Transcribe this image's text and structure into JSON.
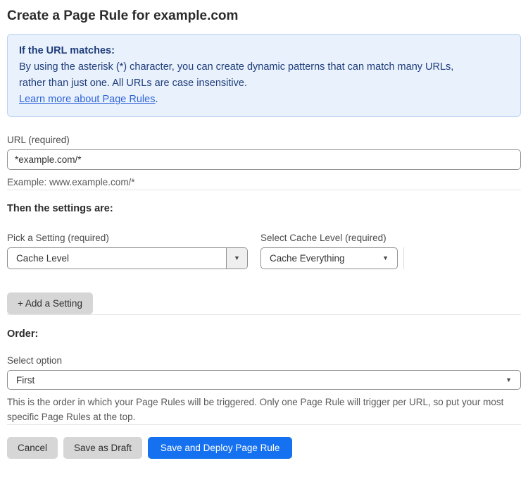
{
  "page": {
    "title": "Create a Page Rule for example.com"
  },
  "info_box": {
    "heading": "If the URL matches:",
    "body": "By using the asterisk (*) character, you can create dynamic patterns that can match many URLs, rather than just one. All URLs are case insensitive.",
    "link_text": "Learn more about Page Rules",
    "link_suffix": "."
  },
  "url_field": {
    "label": "URL (required)",
    "value": "*example.com/*",
    "helper": "Example: www.example.com/*"
  },
  "settings": {
    "heading": "Then the settings are:",
    "setting_label": "Pick a Setting (required)",
    "setting_value": "Cache Level",
    "cache_label": "Select Cache Level (required)",
    "cache_value": "Cache Everything",
    "add_button": "+ Add a Setting",
    "dropdown_arrow": "▼"
  },
  "order": {
    "heading": "Order:",
    "label": "Select option",
    "value": "First",
    "helper": "This is the order in which your Page Rules will be triggered. Only one Page Rule will trigger per URL, so put your most specific Page Rules at the top.",
    "dropdown_arrow": "▼"
  },
  "footer": {
    "cancel": "Cancel",
    "save_draft": "Save as Draft",
    "save_deploy": "Save and Deploy Page Rule"
  },
  "colors": {
    "accent_blue": "#1671f0",
    "info_bg": "#e9f1fc",
    "info_border": "#bcd4f0",
    "info_text": "#1e3d7b",
    "link": "#2e64d9",
    "button_gray": "#d6d6d6"
  }
}
